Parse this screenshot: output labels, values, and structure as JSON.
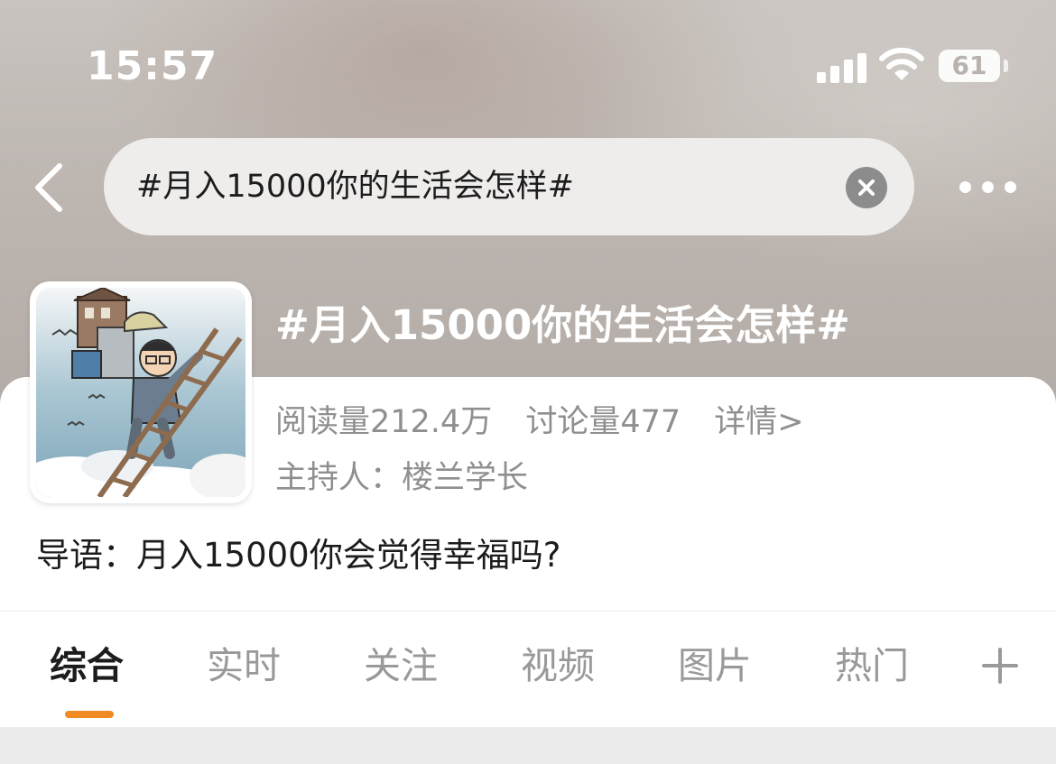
{
  "status_bar": {
    "time": "15:57",
    "battery_level": "61",
    "signal_icon": "cellular-signal-icon",
    "wifi_icon": "wifi-icon"
  },
  "search": {
    "query": "#月入15000你的生活会怎样#",
    "back_icon": "chevron-left-icon",
    "clear_icon": "clear-icon",
    "more_icon": "more-dots-icon"
  },
  "topic": {
    "title": "#月入15000你的生活会怎样#",
    "reads": "阅读量212.4万",
    "discussions": "讨论量477",
    "details_link": "详情>",
    "host": "主持人：楼兰学长",
    "intro": "导语：月入15000你会觉得幸福吗?",
    "cover_image": "cartoon-man-climbing-ladder-carrying-house"
  },
  "tabs": [
    {
      "label": "综合",
      "active": true
    },
    {
      "label": "实时",
      "active": false
    },
    {
      "label": "关注",
      "active": false
    },
    {
      "label": "视频",
      "active": false
    },
    {
      "label": "图片",
      "active": false
    },
    {
      "label": "热门",
      "active": false
    }
  ],
  "add_tab_icon": "plus-icon",
  "colors": {
    "accent": "#f08a24",
    "text_primary": "#1c1c1c",
    "text_secondary": "#8f8f8f",
    "tab_inactive": "#999999"
  }
}
